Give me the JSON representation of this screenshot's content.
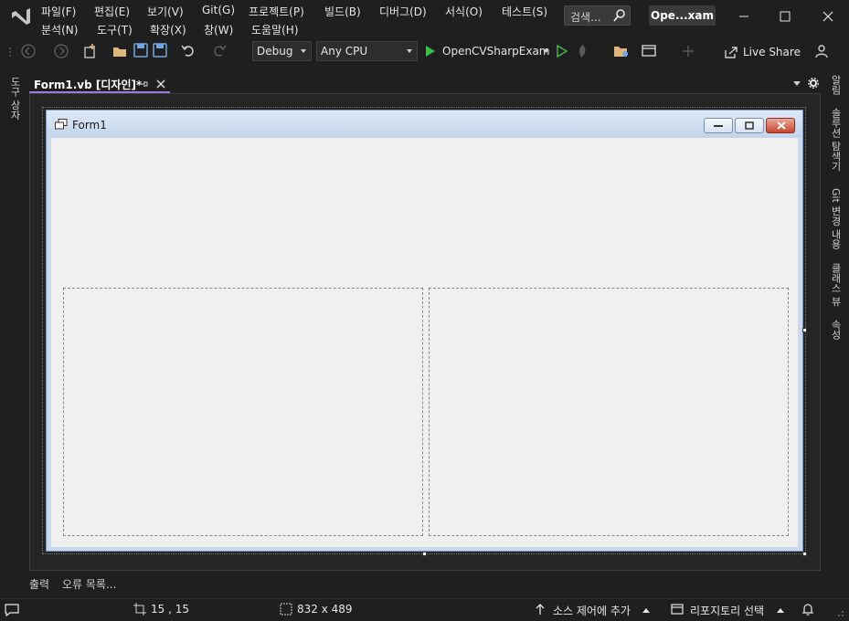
{
  "menu": {
    "file": "파일(F)",
    "edit": "편집(E)",
    "view": "보기(V)",
    "git": "Git(G)",
    "project": "프로젝트(P)",
    "build": "빌드(B)",
    "debug": "디버그(D)",
    "format": "서식(O)",
    "test": "테스트(S)",
    "analyze": "분석(N)",
    "tools": "도구(T)",
    "extensions": "확장(X)",
    "window": "창(W)",
    "help": "도움말(H)"
  },
  "search": {
    "placeholder": "검색..."
  },
  "solution_name": "Ope...xam",
  "toolbar": {
    "config": "Debug",
    "platform": "Any CPU",
    "start_target": "OpenCVSharpExam",
    "live_share": "Live Share"
  },
  "left_rail": {
    "toolbox": "도구 상자"
  },
  "right_rail": {
    "notifications": "알림",
    "solution_explorer": "솔루션 탐색기",
    "git_changes": "Git 변경 내용",
    "class_view": "클래스 뷰",
    "properties": "속성"
  },
  "doc_tab": {
    "label": "Form1.vb [디자인]*"
  },
  "form": {
    "title": "Form1"
  },
  "bottom_tabs": {
    "output": "출력",
    "error_list": "오류 목록..."
  },
  "status": {
    "position": "15 , 15",
    "size": "832 x 489",
    "add_source_control": "소스 제어에 추가",
    "select_repo": "리포지토리 선택"
  },
  "colors": {
    "accent": "#9b7be0",
    "background": "#1f1f1f",
    "form_client": "#f0f0f0"
  },
  "icons": [
    "vs-logo-icon",
    "search-icon",
    "minimize-icon",
    "maximize-icon",
    "close-icon",
    "back-icon",
    "forward-icon",
    "new-project-icon",
    "open-icon",
    "save-icon",
    "save-all-icon",
    "undo-icon",
    "redo-icon",
    "start-icon",
    "start-without-debug-icon",
    "hot-reload-icon",
    "folder-icon",
    "window-layout-icon",
    "live-share-icon",
    "feedback-icon",
    "notification-bell-icon",
    "git-branch-icon",
    "repo-icon"
  ]
}
